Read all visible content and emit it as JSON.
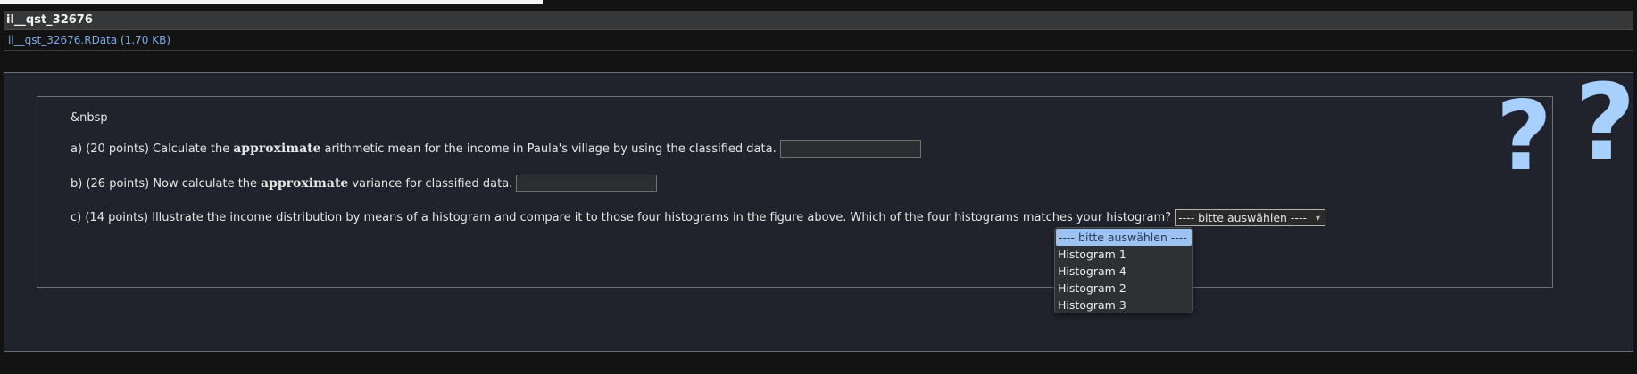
{
  "file": {
    "title": "il__qst_32676",
    "attachment": "il__qst_32676.RData (1.70 KB)"
  },
  "question": {
    "entity": "&nbsp",
    "a": {
      "before": "a) (20 points) Calculate the",
      "emph": "approximate",
      "after": "arithmetic mean for the income in Paula's village by using the classified data."
    },
    "b": {
      "before": "b) (26 points) Now calculate the",
      "emph": "approximate",
      "after": "variance for classified data."
    },
    "c": {
      "text": "c) (14 points) Illustrate the income distribution by means of a histogram and compare it to those four histograms in the figure above. Which of the four histograms matches your histogram?",
      "select_value": "---- bitte auswählen ----"
    }
  },
  "dropdown": {
    "options": [
      "---- bitte auswählen ----",
      "Histogram 1",
      "Histogram 4",
      "Histogram 2",
      "Histogram 3"
    ]
  },
  "decor": {
    "qmark": "?"
  },
  "colors": {
    "accent": "#a8d0ff",
    "link": "#7ca9e6",
    "selected_option": "#9cc3f2"
  }
}
